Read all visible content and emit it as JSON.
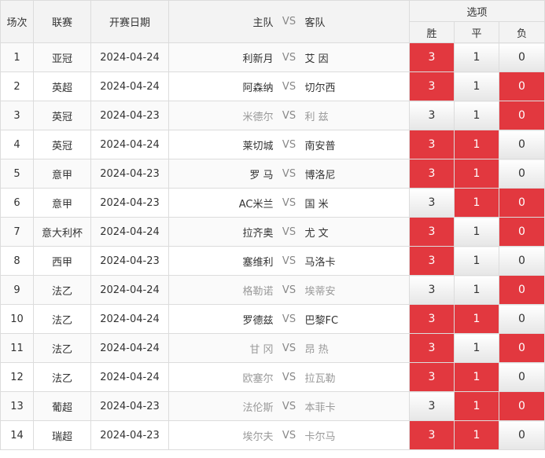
{
  "headers": {
    "index": "场次",
    "league": "联赛",
    "date": "开赛日期",
    "home": "主队",
    "vs": "VS",
    "away": "客队",
    "options": "选项",
    "win": "胜",
    "draw": "平",
    "lose": "负"
  },
  "colors": {
    "selected": "#e2383f",
    "header_bg": "#f3f3f3",
    "border": "#dcdcdc"
  },
  "rows": [
    {
      "no": "1",
      "league": "亚冠",
      "date": "2024-04-24",
      "home": "利新月",
      "away": "艾 因",
      "muted": false,
      "w": "3",
      "d": "1",
      "l": "0",
      "sel": [
        true,
        false,
        false
      ]
    },
    {
      "no": "2",
      "league": "英超",
      "date": "2024-04-24",
      "home": "阿森纳",
      "away": "切尔西",
      "muted": false,
      "w": "3",
      "d": "1",
      "l": "0",
      "sel": [
        true,
        false,
        true
      ]
    },
    {
      "no": "3",
      "league": "英冠",
      "date": "2024-04-23",
      "home": "米德尔",
      "away": "利 兹",
      "muted": true,
      "w": "3",
      "d": "1",
      "l": "0",
      "sel": [
        false,
        false,
        true
      ]
    },
    {
      "no": "4",
      "league": "英冠",
      "date": "2024-04-24",
      "home": "莱切城",
      "away": "南安普",
      "muted": false,
      "w": "3",
      "d": "1",
      "l": "0",
      "sel": [
        true,
        true,
        false
      ]
    },
    {
      "no": "5",
      "league": "意甲",
      "date": "2024-04-23",
      "home": "罗 马",
      "away": "博洛尼",
      "muted": false,
      "w": "3",
      "d": "1",
      "l": "0",
      "sel": [
        true,
        true,
        false
      ]
    },
    {
      "no": "6",
      "league": "意甲",
      "date": "2024-04-23",
      "home": "AC米兰",
      "away": "国 米",
      "muted": false,
      "w": "3",
      "d": "1",
      "l": "0",
      "sel": [
        false,
        true,
        true
      ]
    },
    {
      "no": "7",
      "league": "意大利杯",
      "date": "2024-04-24",
      "home": "拉齐奥",
      "away": "尤 文",
      "muted": false,
      "w": "3",
      "d": "1",
      "l": "0",
      "sel": [
        true,
        false,
        true
      ]
    },
    {
      "no": "8",
      "league": "西甲",
      "date": "2024-04-23",
      "home": "塞维利",
      "away": "马洛卡",
      "muted": false,
      "w": "3",
      "d": "1",
      "l": "0",
      "sel": [
        true,
        false,
        false
      ]
    },
    {
      "no": "9",
      "league": "法乙",
      "date": "2024-04-24",
      "home": "格勒诺",
      "away": "埃蒂安",
      "muted": true,
      "w": "3",
      "d": "1",
      "l": "0",
      "sel": [
        false,
        false,
        true
      ]
    },
    {
      "no": "10",
      "league": "法乙",
      "date": "2024-04-24",
      "home": "罗德兹",
      "away": "巴黎FC",
      "muted": false,
      "w": "3",
      "d": "1",
      "l": "0",
      "sel": [
        true,
        true,
        false
      ]
    },
    {
      "no": "11",
      "league": "法乙",
      "date": "2024-04-24",
      "home": "甘 冈",
      "away": "昂 热",
      "muted": true,
      "w": "3",
      "d": "1",
      "l": "0",
      "sel": [
        true,
        false,
        true
      ]
    },
    {
      "no": "12",
      "league": "法乙",
      "date": "2024-04-24",
      "home": "欧塞尔",
      "away": "拉瓦勒",
      "muted": true,
      "w": "3",
      "d": "1",
      "l": "0",
      "sel": [
        true,
        true,
        false
      ]
    },
    {
      "no": "13",
      "league": "葡超",
      "date": "2024-04-23",
      "home": "法伦斯",
      "away": "本菲卡",
      "muted": true,
      "w": "3",
      "d": "1",
      "l": "0",
      "sel": [
        false,
        true,
        true
      ]
    },
    {
      "no": "14",
      "league": "瑞超",
      "date": "2024-04-23",
      "home": "埃尔夫",
      "away": "卡尔马",
      "muted": true,
      "w": "3",
      "d": "1",
      "l": "0",
      "sel": [
        true,
        true,
        false
      ]
    }
  ]
}
